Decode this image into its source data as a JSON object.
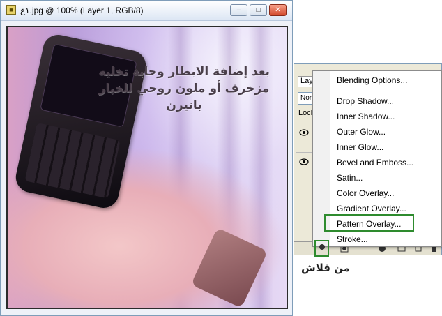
{
  "document": {
    "title": "١ع.jpg @ 100% (Layer 1, RGB/8)",
    "minimize": "–",
    "maximize": "□",
    "close": "✕",
    "canvas_text_lines": [
      "بعد إضافة الابطار وحابة تخليه",
      "مزخرف أو ملون روحي للخيار",
      "باتيرن"
    ]
  },
  "layers_panel": {
    "tab_label": "Lay",
    "blend_mode": "Nor",
    "lock_label": "Lock"
  },
  "context_menu": {
    "items": [
      "Blending Options...",
      "Drop Shadow...",
      "Inner Shadow...",
      "Outer Glow...",
      "Inner Glow...",
      "Bevel and Emboss...",
      "Satin...",
      "Color Overlay...",
      "Gradient Overlay...",
      "Pattern Overlay...",
      "Stroke..."
    ],
    "highlighted_item": "Pattern Overlay..."
  },
  "annotation": {
    "text": "من فلاش"
  },
  "icons": {
    "document": "jpg-document-icon",
    "visibility": "eye-icon",
    "layer_style": "fx-layer-style-icon"
  },
  "colors": {
    "highlight": "#2e8b2e"
  }
}
